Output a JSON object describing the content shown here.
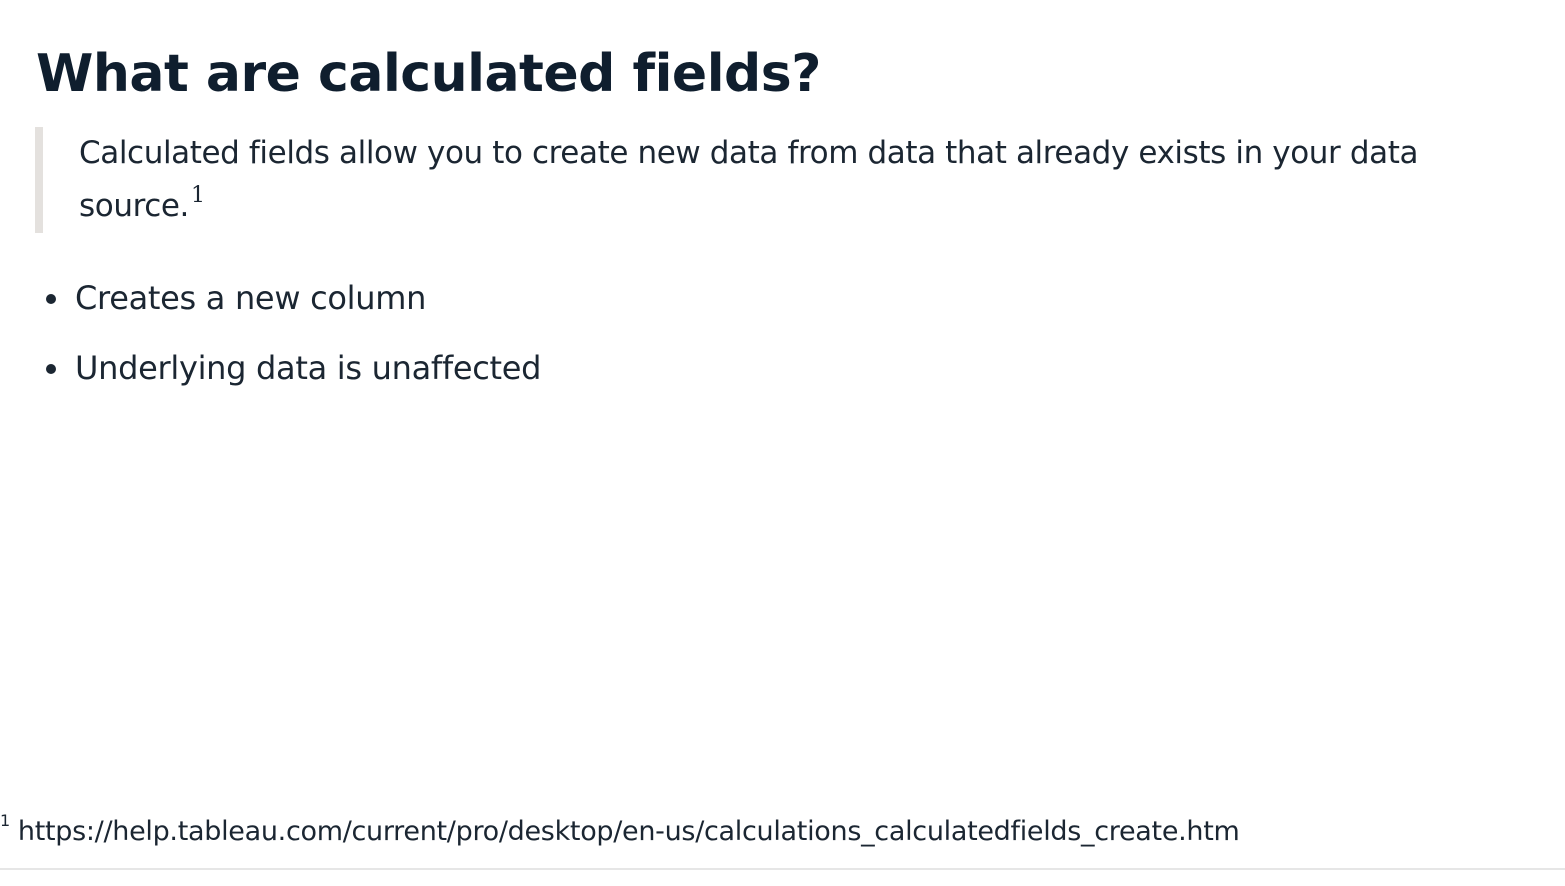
{
  "slide": {
    "title": "What are calculated fields?",
    "quote": {
      "line1": "Calculated fields allow you to create new data from data that already exists in your data",
      "line2": "source.",
      "footnote_ref": "1"
    },
    "bullets": [
      "Creates a new column",
      "Underlying data is unaffected"
    ],
    "footnote": {
      "marker": "1",
      "text": "https://help.tableau.com/current/pro/desktop/en-us/calculations_calculatedfields_create.htm"
    }
  }
}
